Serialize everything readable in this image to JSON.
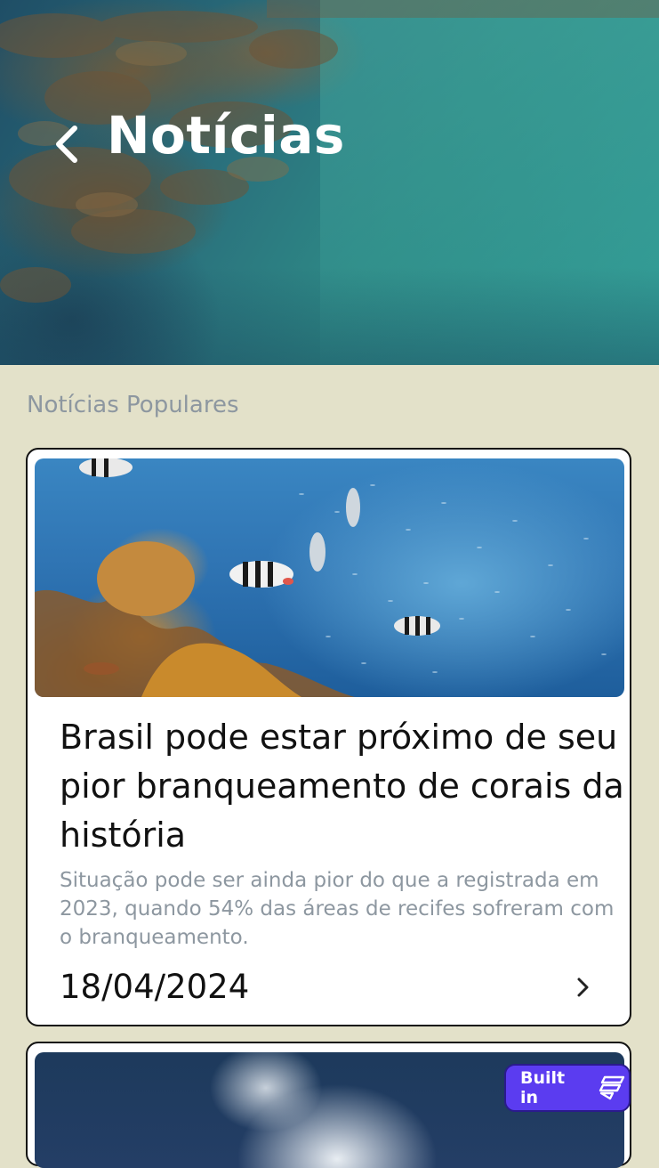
{
  "header": {
    "title": "Notícias",
    "back_icon": "chevron-left-icon"
  },
  "section": {
    "label": "Notícias Populares"
  },
  "cards": [
    {
      "title": "Brasil pode estar próximo de seu pior branqueamento de corais da história",
      "description": "Situação pode ser ainda pior do que a registrada em 2023, quando 54% das áreas de recifes sofreram com o branqueamento.",
      "date": "18/04/2024",
      "icon": "chevron-right-icon"
    },
    {
      "title": "",
      "description": "",
      "date": ""
    }
  ],
  "badge": {
    "label": "Built in"
  },
  "colors": {
    "background": "#e3e1c9",
    "muted_text": "#8d97a0",
    "badge": "#5b3cf0"
  }
}
